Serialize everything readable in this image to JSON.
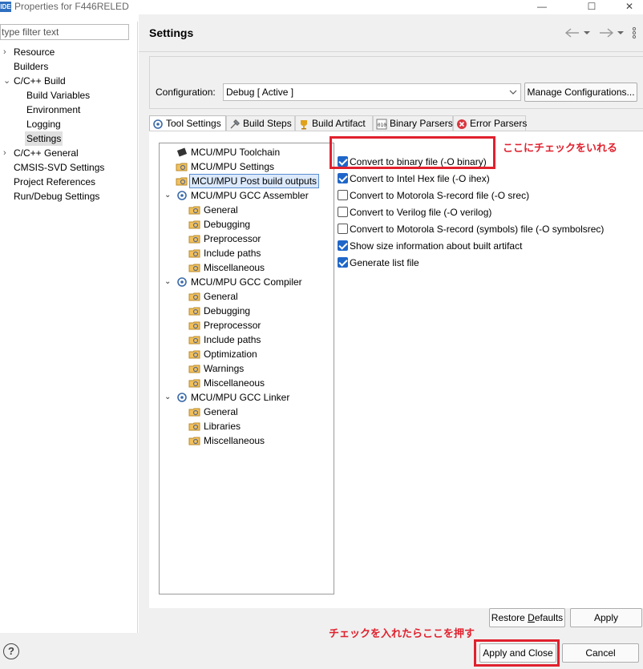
{
  "window": {
    "logo": "IDE",
    "title": "Properties for F446RELED",
    "minimize": "—",
    "maximize": "☐",
    "close": "✕"
  },
  "left": {
    "filter_placeholder": "type filter text",
    "items": [
      {
        "label": "Resource",
        "arrow": "›"
      },
      {
        "label": "Builders",
        "arrow": ""
      },
      {
        "label": "C/C++ Build",
        "arrow": "⌄"
      },
      {
        "label": "Build Variables",
        "arrow": ""
      },
      {
        "label": "Environment",
        "arrow": ""
      },
      {
        "label": "Logging",
        "arrow": ""
      },
      {
        "label": "Settings",
        "arrow": ""
      },
      {
        "label": "C/C++ General",
        "arrow": "›"
      },
      {
        "label": "CMSIS-SVD Settings",
        "arrow": ""
      },
      {
        "label": "Project References",
        "arrow": ""
      },
      {
        "label": "Run/Debug Settings",
        "arrow": ""
      }
    ]
  },
  "header": {
    "title": "Settings",
    "icons": [
      "back-icon",
      "dropdown-icon",
      "forward-icon",
      "dropdown-icon",
      "more-icon"
    ]
  },
  "config": {
    "label": "Configuration:",
    "value": "Debug  [ Active ]",
    "manage_label": "Manage Configurations..."
  },
  "tabs": [
    {
      "label": "Tool Settings",
      "icon": "tool-settings-icon",
      "active": true
    },
    {
      "label": "Build Steps",
      "icon": "build-steps-icon",
      "active": false
    },
    {
      "label": "Build Artifact",
      "icon": "build-artifact-icon",
      "active": false
    },
    {
      "label": "Binary Parsers",
      "icon": "binary-parsers-icon",
      "active": false
    },
    {
      "label": "Error Parsers",
      "icon": "error-parsers-icon",
      "active": false
    }
  ],
  "tree": [
    {
      "label": "MCU/MPU Toolchain",
      "icon": "chip-icon",
      "level": 0,
      "arrow": ""
    },
    {
      "label": "MCU/MPU Settings",
      "icon": "settings-folder-icon",
      "level": 0,
      "arrow": ""
    },
    {
      "label": "MCU/MPU Post build outputs",
      "icon": "settings-folder-icon",
      "level": 0,
      "arrow": "",
      "selected": true
    },
    {
      "label": "MCU/MPU GCC Assembler",
      "icon": "tool-gear-icon",
      "level": 0,
      "arrow": "⌄"
    },
    {
      "label": "General",
      "icon": "settings-folder-icon",
      "level": 1
    },
    {
      "label": "Debugging",
      "icon": "settings-folder-icon",
      "level": 1
    },
    {
      "label": "Preprocessor",
      "icon": "settings-folder-icon",
      "level": 1
    },
    {
      "label": "Include paths",
      "icon": "settings-folder-icon",
      "level": 1
    },
    {
      "label": "Miscellaneous",
      "icon": "settings-folder-icon",
      "level": 1
    },
    {
      "label": "MCU/MPU GCC Compiler",
      "icon": "tool-gear-icon",
      "level": 0,
      "arrow": "⌄"
    },
    {
      "label": "General",
      "icon": "settings-folder-icon",
      "level": 1
    },
    {
      "label": "Debugging",
      "icon": "settings-folder-icon",
      "level": 1
    },
    {
      "label": "Preprocessor",
      "icon": "settings-folder-icon",
      "level": 1
    },
    {
      "label": "Include paths",
      "icon": "settings-folder-icon",
      "level": 1
    },
    {
      "label": "Optimization",
      "icon": "settings-folder-icon",
      "level": 1
    },
    {
      "label": "Warnings",
      "icon": "settings-folder-icon",
      "level": 1
    },
    {
      "label": "Miscellaneous",
      "icon": "settings-folder-icon",
      "level": 1
    },
    {
      "label": "MCU/MPU GCC Linker",
      "icon": "tool-gear-icon",
      "level": 0,
      "arrow": "⌄"
    },
    {
      "label": "General",
      "icon": "settings-folder-icon",
      "level": 1
    },
    {
      "label": "Libraries",
      "icon": "settings-folder-icon",
      "level": 1
    },
    {
      "label": "Miscellaneous",
      "icon": "settings-folder-icon",
      "level": 1
    }
  ],
  "options": [
    {
      "label": "Convert to binary file (-O binary)",
      "checked": true
    },
    {
      "label": "Convert to Intel Hex file (-O ihex)",
      "checked": true
    },
    {
      "label": "Convert to Motorola S-record file (-O srec)",
      "checked": false
    },
    {
      "label": "Convert to Verilog file (-O verilog)",
      "checked": false
    },
    {
      "label": "Convert to Motorola S-record (symbols) file (-O symbolsrec)",
      "checked": false
    },
    {
      "label": "Show size information about built artifact",
      "checked": true
    },
    {
      "label": "Generate list file",
      "checked": true
    }
  ],
  "annotations": {
    "note_checkbox": "ここにチェックをいれる",
    "note_apply": "チェックを入れたらここを押す",
    "color": "#e0212e"
  },
  "buttons": {
    "restore_defaults": "Restore Defaults",
    "apply": "Apply",
    "apply_and_close": "Apply and Close",
    "cancel": "Cancel",
    "help": "?"
  }
}
